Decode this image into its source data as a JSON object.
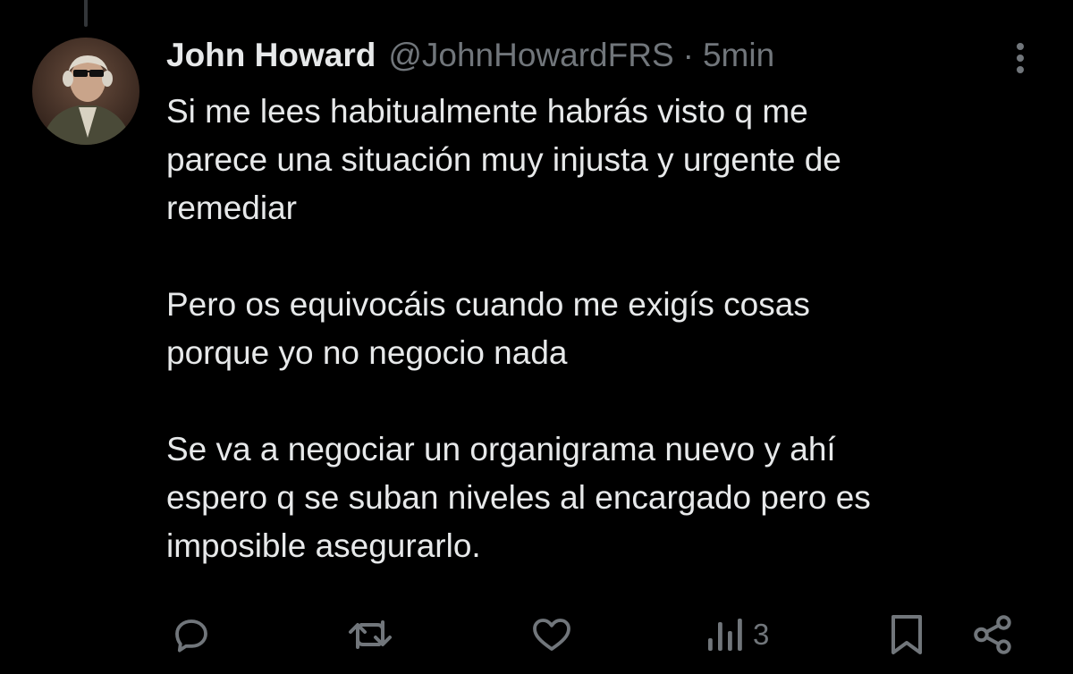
{
  "tweet": {
    "author_name": "John Howard",
    "handle": "@JohnHowardFRS",
    "separator": "·",
    "time": "5min",
    "paragraphs": [
      [
        "Si me lees habitualmente habrás visto q me",
        "parece una situación muy injusta y urgente de",
        "remediar"
      ],
      [
        "Pero os equivocáis cuando me exigís cosas",
        "porque yo no negocio nada"
      ],
      [
        "Se va a negociar un organigrama nuevo y ahí",
        "espero q se suban niveles al encargado pero es",
        "imposible asegurarlo."
      ]
    ]
  },
  "actions": {
    "reply_icon": "reply-icon",
    "retweet_icon": "retweet-icon",
    "like_icon": "heart-icon",
    "views_icon": "views-icon",
    "views_count": "3",
    "bookmark_icon": "bookmark-icon",
    "share_icon": "share-icon"
  },
  "colors": {
    "background": "#000000",
    "text_primary": "#e7e9ea",
    "text_secondary": "#71767b",
    "thread_line": "#333639"
  }
}
